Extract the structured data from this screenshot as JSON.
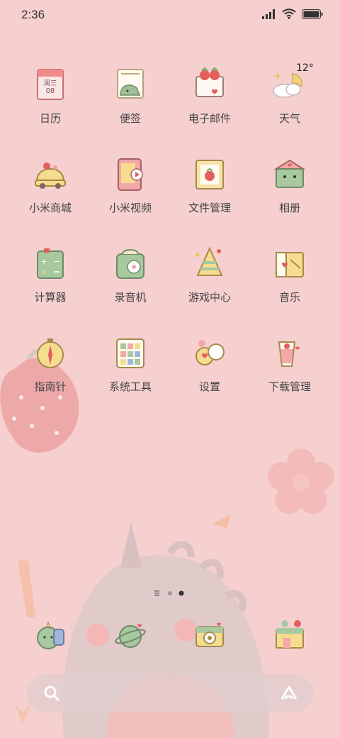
{
  "status": {
    "time": "2:36",
    "icons": [
      "signal-icon",
      "wifi-icon",
      "battery-icon"
    ]
  },
  "apps": [
    {
      "label": "日历",
      "icon": "calendar-icon",
      "calendar_weekday": "周三",
      "calendar_day": "08"
    },
    {
      "label": "便签",
      "icon": "notes-icon"
    },
    {
      "label": "电子邮件",
      "icon": "email-icon"
    },
    {
      "label": "天气",
      "icon": "weather-icon",
      "temp": "12°"
    },
    {
      "label": "小米商城",
      "icon": "store-icon"
    },
    {
      "label": "小米视频",
      "icon": "video-icon"
    },
    {
      "label": "文件管理",
      "icon": "files-icon"
    },
    {
      "label": "相册",
      "icon": "gallery-icon"
    },
    {
      "label": "计算器",
      "icon": "calculator-icon"
    },
    {
      "label": "录音机",
      "icon": "recorder-icon"
    },
    {
      "label": "游戏中心",
      "icon": "game-center-icon"
    },
    {
      "label": "音乐",
      "icon": "music-icon"
    },
    {
      "label": "指南针",
      "icon": "compass-icon"
    },
    {
      "label": "系统工具",
      "icon": "system-tools-icon"
    },
    {
      "label": "设置",
      "icon": "settings-icon"
    },
    {
      "label": "下载管理",
      "icon": "downloads-icon"
    }
  ],
  "dock": [
    {
      "icon": "phone-icon"
    },
    {
      "icon": "browser-icon"
    },
    {
      "icon": "camera-icon"
    },
    {
      "icon": "app-store-icon"
    }
  ],
  "page_indicator": {
    "pages": 2,
    "current": 2
  },
  "search": {
    "icon": "search-icon",
    "assistant_icon": "assistant-icon"
  },
  "colors": {
    "background": "#f6cfcf",
    "label": "#444444",
    "accent": "#e37b7b"
  }
}
